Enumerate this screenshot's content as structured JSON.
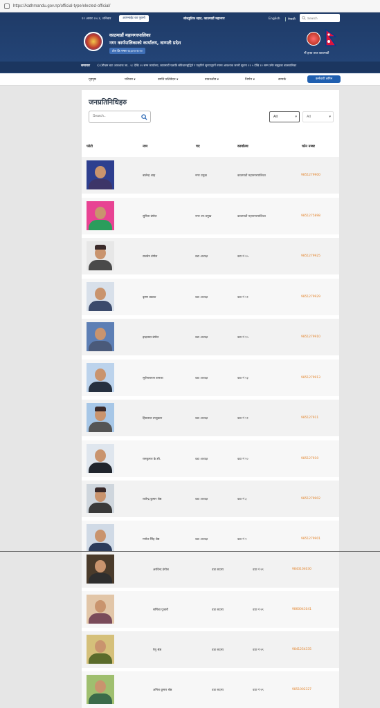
{
  "browser": {
    "url": "https://kathmandu.gov.np/official-type/elected-official/"
  },
  "header": {
    "date": "१२ असार २०८१, शनिबार",
    "old_site": "आफ्नाईट का पुरानो",
    "address": "सोलडुटिक ब्हाट, काठमाडौं महानगर",
    "lang_en": "English",
    "lang_np": "नेपाली",
    "search_placeholder": "Search",
    "org_line1": "काठमाडौं महानगरपालिका",
    "org_line2": "नगर कार्यपालिकाको कार्यालय, वाग्मती प्रदेश",
    "tollfree": "टोल फ्रि नम्बर १६६०१०१०१०",
    "flag_caption": "नौं हाम्रा ताज काठमाडौं"
  },
  "news": {
    "label": "समाचार",
    "text": "१) (मौखम बाट आवश्यक जा.. १८ देखि २२ सम्म कार्यालय, काठमाडौं   पछाडि संविधानसुद्धिने र यकृतिने सुनाउनुपर्ने रुपमा आवश्यक जरुरी सूचना ११   ५ देखि १२ सम्म उमेर समूहका बालबालिका"
  },
  "nav": {
    "items": [
      "गृहपृष्ठ",
      "परिचय ▾",
      "प्रगति प्रतिवेदन ▾",
      "डाउनलोड ▾",
      "निर्णय ▾",
      "सम्पर्क"
    ],
    "staff_login": "कर्मचारी लगिन"
  },
  "main": {
    "title": "जनप्रतिनिधिहरु",
    "search_placeholder": "Search..",
    "filter1": "All",
    "filter2": "All",
    "columns": [
      "फोटो",
      "नाम",
      "पद",
      "कार्यालय",
      "फोन नम्बर"
    ]
  },
  "rows": [
    {
      "name": "बालेन्द्र शाह",
      "post": "नगर प्रमुख",
      "office": "काठमाडौं महानगरपालिका",
      "phone": "9851279900"
    },
    {
      "name": "सुनिता डंगोल",
      "post": "नगर उप-प्रमुख",
      "office": "काठमाडौं महानगरपालिका",
      "phone": "9851275898"
    },
    {
      "name": "सञ्जेन डंगोल",
      "post": "वडा अध्यक्ष",
      "office": "वडा नं २५",
      "phone": "9851279925"
    },
    {
      "name": "कृष्ण प्रकाश",
      "post": "वडा अध्यक्ष",
      "office": "वडा नं २१",
      "phone": "9851279929"
    },
    {
      "name": "इन्द्रलाल डंगोल",
      "post": "वडा अध्यक्ष",
      "office": "वडा नं १५",
      "phone": "9851279910"
    },
    {
      "name": "सूर्यनारायण बानजा",
      "post": "वडा अध्यक्ष",
      "office": "वडा नं १३",
      "phone": "9851279913"
    },
    {
      "name": "हिरालाल तण्डुकार",
      "post": "वडा अध्यक्ष",
      "office": "वडा नं ११",
      "phone": "985127911"
    },
    {
      "name": "रामकुमार के.सी.",
      "post": "वडा अध्यक्ष",
      "office": "वडा नं १०",
      "phone": "985127910"
    },
    {
      "name": "राजेन्द्र कुमार श्रेष्ठ",
      "post": "वडा अध्यक्ष",
      "office": "वडा नं ३",
      "phone": "9851279902"
    },
    {
      "name": "मनोज सिंह श्रेष्ठ",
      "post": "वडा अध्यक्ष",
      "office": "वडा नं १",
      "phone": "9851279901"
    },
    {
      "name": "अरविन्द डंगोल",
      "post": "वडा सदस्य",
      "office": "वडा नं २९",
      "phone": "9843104030"
    },
    {
      "name": "सर्मिला पुजारी",
      "post": "वडा सदस्य",
      "office": "वडा नं २९",
      "phone": "9860041041"
    },
    {
      "name": "रेणु श्रेष्ठ",
      "post": "वडा सदस्य",
      "office": "वडा नं २९",
      "phone": "9841254335"
    },
    {
      "name": "अनिल कुमार श्रेष्ठ",
      "post": "वडा सदस्य",
      "office": "वडा नं २९",
      "phone": "9851002327"
    }
  ],
  "colors": {
    "header": "#1f3b67",
    "phone": "#e3832a",
    "button": "#1f5fb0"
  }
}
